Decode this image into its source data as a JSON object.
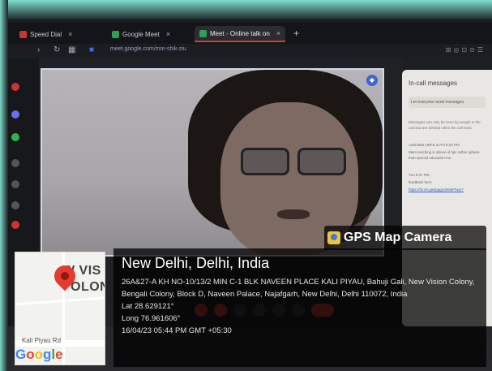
{
  "browser": {
    "tabs": [
      {
        "label": "Speed Dial"
      },
      {
        "label": "Google Meet"
      },
      {
        "label": "Meet - Online talk on"
      }
    ],
    "url": "meet.google.com/mnr-shik-ziu"
  },
  "chat": {
    "title": "In-call messages",
    "toggle": "Let everyone send messages",
    "info": "Messages can only be seen by people in the call and are deleted when the call ends",
    "messages": [
      {
        "text": "Aarti1965 HDFE & Pol 5:23 PM"
      },
      {
        "text": "Mam teaching is above of tips rather sphere than special education me"
      },
      {
        "text": "You 5:37 PM"
      },
      {
        "text": "feedback form"
      },
      {
        "text": "https://forms.gle/ppgvo9SwFhwu7"
      }
    ]
  },
  "gps": {
    "app_name": "GPS Map Camera",
    "place": "New Delhi, Delhi, India",
    "address": "26A&27-A KH NO-10/13/2 MIN C-1 BLK NAVEEN PLACE KALI PIYAU, Bahuji Gali, New Vision Colony, Bengali Colony, Block D, Naveen Palace, Najafgarh, New Delhi, Delhi 110072, India",
    "lat": "Lat 28.629121°",
    "long": "Long 76.961606°",
    "timestamp": "16/04/23 05:44 PM GMT +05:30"
  },
  "map": {
    "label_top": "W VIS",
    "label_mid": "OLON",
    "road": "Kali Piyau Rd",
    "brand": "Google"
  },
  "colors": {
    "accent": "#e0392e",
    "pin": "#e53b2f"
  }
}
